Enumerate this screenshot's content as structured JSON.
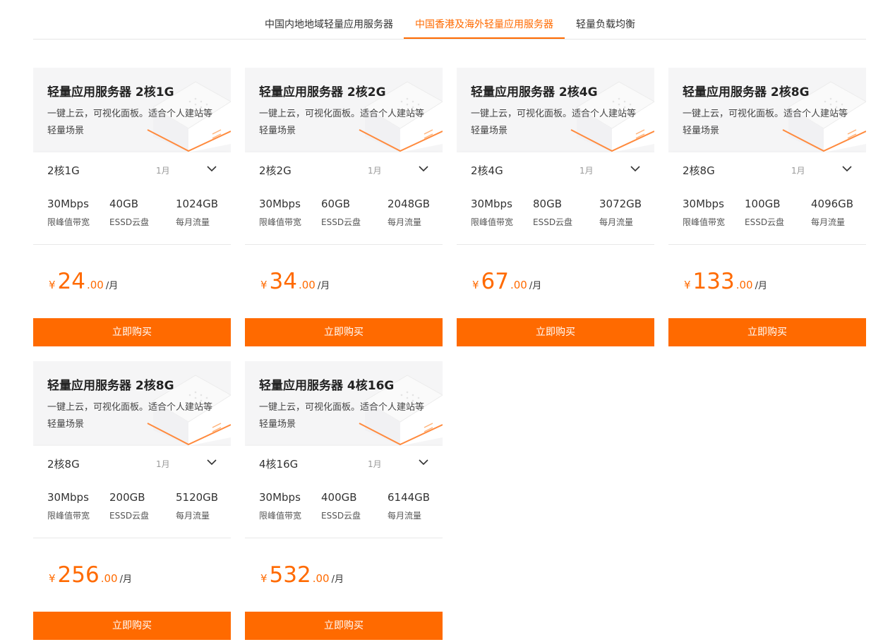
{
  "tabs": [
    {
      "label": "中国内地地域轻量应用服务器",
      "active": false
    },
    {
      "label": "中国香港及海外轻量应用服务器",
      "active": true
    },
    {
      "label": "轻量负载均衡",
      "active": false
    }
  ],
  "accent_color": "#ff6a00",
  "cards": [
    {
      "title": "轻量应用服务器 2核1G",
      "desc": "一键上云，可视化面板。适合个人建站等轻量场景",
      "spec": "2核1G",
      "period": "1月",
      "metrics": [
        {
          "value": "30Mbps",
          "label": "限峰值带宽"
        },
        {
          "value": "40GB",
          "label": "ESSD云盘"
        },
        {
          "value": "1024GB",
          "label": "每月流量"
        }
      ],
      "price": {
        "currency": "¥",
        "integer": "24",
        "decimal": ".00",
        "unit": "/月"
      },
      "button": "立即购买"
    },
    {
      "title": "轻量应用服务器 2核2G",
      "desc": "一键上云，可视化面板。适合个人建站等轻量场景",
      "spec": "2核2G",
      "period": "1月",
      "metrics": [
        {
          "value": "30Mbps",
          "label": "限峰值带宽"
        },
        {
          "value": "60GB",
          "label": "ESSD云盘"
        },
        {
          "value": "2048GB",
          "label": "每月流量"
        }
      ],
      "price": {
        "currency": "¥",
        "integer": "34",
        "decimal": ".00",
        "unit": "/月"
      },
      "button": "立即购买"
    },
    {
      "title": "轻量应用服务器 2核4G",
      "desc": "一键上云，可视化面板。适合个人建站等轻量场景",
      "spec": "2核4G",
      "period": "1月",
      "metrics": [
        {
          "value": "30Mbps",
          "label": "限峰值带宽"
        },
        {
          "value": "80GB",
          "label": "ESSD云盘"
        },
        {
          "value": "3072GB",
          "label": "每月流量"
        }
      ],
      "price": {
        "currency": "¥",
        "integer": "67",
        "decimal": ".00",
        "unit": "/月"
      },
      "button": "立即购买"
    },
    {
      "title": "轻量应用服务器 2核8G",
      "desc": "一键上云，可视化面板。适合个人建站等轻量场景",
      "spec": "2核8G",
      "period": "1月",
      "metrics": [
        {
          "value": "30Mbps",
          "label": "限峰值带宽"
        },
        {
          "value": "100GB",
          "label": "ESSD云盘"
        },
        {
          "value": "4096GB",
          "label": "每月流量"
        }
      ],
      "price": {
        "currency": "¥",
        "integer": "133",
        "decimal": ".00",
        "unit": "/月"
      },
      "button": "立即购买"
    },
    {
      "title": "轻量应用服务器 2核8G",
      "desc": "一键上云，可视化面板。适合个人建站等轻量场景",
      "spec": "2核8G",
      "period": "1月",
      "metrics": [
        {
          "value": "30Mbps",
          "label": "限峰值带宽"
        },
        {
          "value": "200GB",
          "label": "ESSD云盘"
        },
        {
          "value": "5120GB",
          "label": "每月流量"
        }
      ],
      "price": {
        "currency": "¥",
        "integer": "256",
        "decimal": ".00",
        "unit": "/月"
      },
      "button": "立即购买"
    },
    {
      "title": "轻量应用服务器 4核16G",
      "desc": "一键上云，可视化面板。适合个人建站等轻量场景",
      "spec": "4核16G",
      "period": "1月",
      "metrics": [
        {
          "value": "30Mbps",
          "label": "限峰值带宽"
        },
        {
          "value": "400GB",
          "label": "ESSD云盘"
        },
        {
          "value": "6144GB",
          "label": "每月流量"
        }
      ],
      "price": {
        "currency": "¥",
        "integer": "532",
        "decimal": ".00",
        "unit": "/月"
      },
      "button": "立即购买"
    }
  ]
}
